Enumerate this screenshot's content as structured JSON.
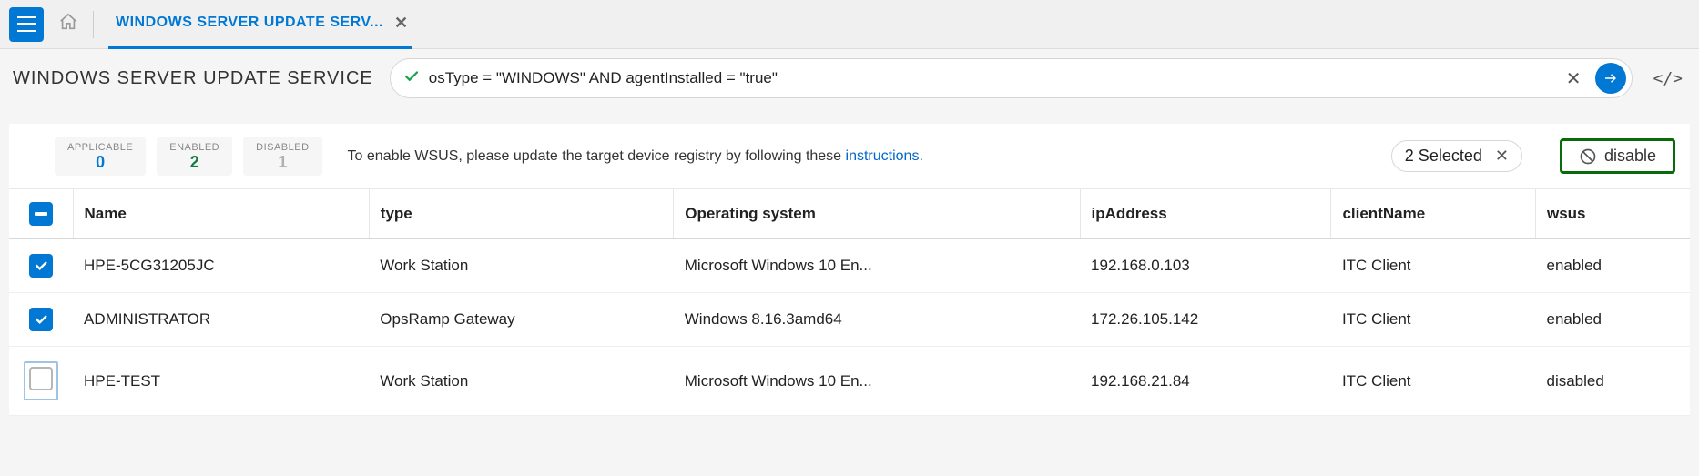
{
  "topbar": {
    "tab_title": "WINDOWS SERVER UPDATE SERV..."
  },
  "page": {
    "title": "WINDOWS SERVER UPDATE SERVICE"
  },
  "query": {
    "value": "osType = \"WINDOWS\" AND agentInstalled = \"true\""
  },
  "filters": {
    "applicable": {
      "label": "APPLICABLE",
      "count": "0"
    },
    "enabled": {
      "label": "ENABLED",
      "count": "2"
    },
    "disabled": {
      "label": "DISABLED",
      "count": "1"
    }
  },
  "notice": {
    "prefix": "To enable WSUS, please update the target device registry by following these ",
    "link_text": "instructions",
    "suffix": "."
  },
  "selection": {
    "text": "2 Selected"
  },
  "action": {
    "disable_label": "disable"
  },
  "table": {
    "headers": {
      "name": "Name",
      "type": "type",
      "os": "Operating system",
      "ip": "ipAddress",
      "client": "clientName",
      "wsus": "wsus"
    },
    "rows": [
      {
        "checked": true,
        "highlight": false,
        "name": "HPE-5CG31205JC",
        "type": "Work Station",
        "os": "Microsoft Windows 10 En...",
        "ip": "192.168.0.103",
        "client": "ITC Client",
        "wsus": "enabled"
      },
      {
        "checked": true,
        "highlight": false,
        "name": "ADMINISTRATOR",
        "type": "OpsRamp Gateway",
        "os": "Windows 8.16.3amd64",
        "ip": "172.26.105.142",
        "client": "ITC Client",
        "wsus": "enabled"
      },
      {
        "checked": false,
        "highlight": true,
        "name": "HPE-TEST",
        "type": "Work Station",
        "os": "Microsoft Windows 10 En...",
        "ip": "192.168.21.84",
        "client": "ITC Client",
        "wsus": "disabled"
      }
    ]
  }
}
